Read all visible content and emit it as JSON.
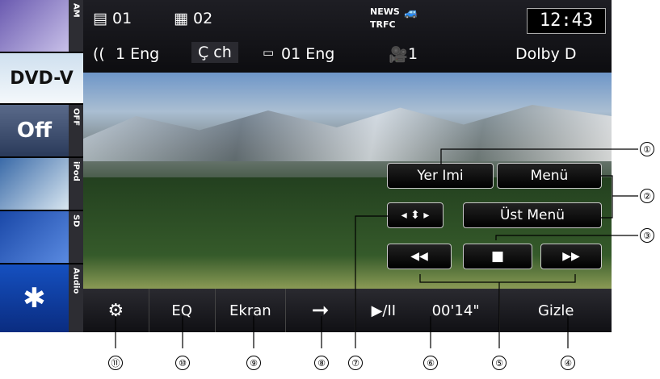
{
  "sources": [
    {
      "tab": "AM",
      "thumb": ""
    },
    {
      "tab": "",
      "thumb": "DVD-V"
    },
    {
      "tab": "OFF",
      "thumb": "Off"
    },
    {
      "tab": "iPod",
      "thumb": ""
    },
    {
      "tab": "SD",
      "thumb": ""
    },
    {
      "tab": "Audio",
      "thumb": ""
    }
  ],
  "info": {
    "title": "01",
    "chapter": "02",
    "audio": "1 Eng",
    "channel": "Ç ch",
    "subtitle": "01 Eng",
    "angle": "1",
    "news": "NEWS",
    "trfc": "TRFC",
    "clock": "12:43",
    "dolby": "Dolby D"
  },
  "video_buttons": {
    "bookmark": "Yer Imi",
    "menu": "Menü",
    "top_menu": "Üst Menü",
    "arrows": "◂ ⬍ ▸",
    "stop": "■",
    "prev": "◀◀",
    "next": "▶▶"
  },
  "bottom": {
    "settings": "⚙",
    "eq": "EQ",
    "screen": "Ekran",
    "arrow": "➞",
    "playpause": "▶/II",
    "time": "00'14\"",
    "hide": "Gizle"
  },
  "callouts": [
    "①",
    "②",
    "③",
    "④",
    "⑤",
    "⑥",
    "⑦",
    "⑧",
    "⑨",
    "⑩",
    "⑪"
  ]
}
